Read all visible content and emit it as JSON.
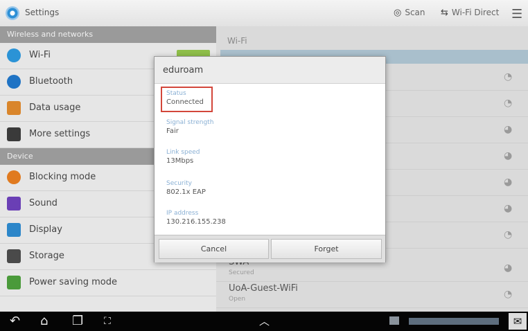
{
  "topbar": {
    "title": "Settings",
    "scan_label": "Scan",
    "wifi_direct_label": "Wi-Fi Direct"
  },
  "sidebar": {
    "section_wireless": "Wireless and networks",
    "section_device": "Device",
    "items": [
      {
        "label": "Wi-Fi",
        "icon": "wifi-icon",
        "color": "#2b93d6"
      },
      {
        "label": "Bluetooth",
        "icon": "bluetooth-icon",
        "color": "#1f73c4"
      },
      {
        "label": "Data usage",
        "icon": "data-usage-icon",
        "color": "#d9852b"
      },
      {
        "label": "More settings",
        "icon": "more-icon",
        "color": "#3a3a3a"
      },
      {
        "label": "Blocking mode",
        "icon": "blocking-icon",
        "color": "#e07a1f"
      },
      {
        "label": "Sound",
        "icon": "sound-icon",
        "color": "#6a3fb5"
      },
      {
        "label": "Display",
        "icon": "display-icon",
        "color": "#2c86c9"
      },
      {
        "label": "Storage",
        "icon": "storage-icon",
        "color": "#4a4a4a"
      },
      {
        "label": "Power saving mode",
        "icon": "power-saving-icon",
        "color": "#4a9a3a"
      }
    ]
  },
  "wifi_panel": {
    "title": "Wi-Fi",
    "networks": [
      {
        "name": "SWA",
        "sub": "Secured"
      },
      {
        "name": "UoA-Guest-WiFi",
        "sub": "Open"
      }
    ]
  },
  "dialog": {
    "title": "eduroam",
    "fields": [
      {
        "label": "Status",
        "value": "Connected"
      },
      {
        "label": "Signal strength",
        "value": "Fair"
      },
      {
        "label": "Link speed",
        "value": "13Mbps"
      },
      {
        "label": "Security",
        "value": "802.1x EAP"
      },
      {
        "label": "IP address",
        "value": "130.216.155.238"
      }
    ],
    "cancel_label": "Cancel",
    "forget_label": "Forget"
  },
  "colors": {
    "highlight": "#d3463a",
    "field_label": "#8ab0d4"
  }
}
